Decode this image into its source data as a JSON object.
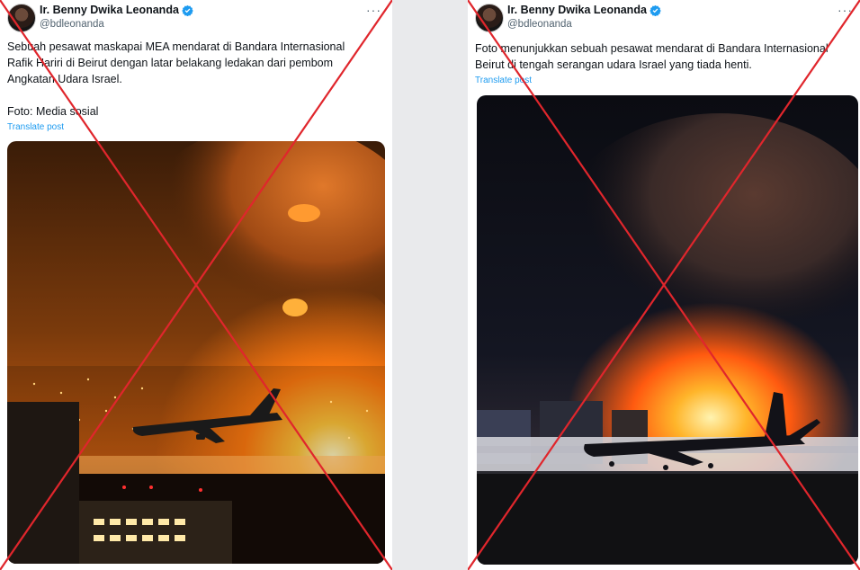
{
  "left_post": {
    "author_name": "Ir. Benny Dwika Leonanda",
    "handle": "@bdleonanda",
    "text": "Sebuah pesawat maskapai MEA mendarat di Bandara Internasional\nRafik Hariri di Beirut dengan latar belakang ledakan dari pembom\nAngkatan Udara Israel.\n\nFoto: Media sosial",
    "translate_label": "Translate post",
    "more_label": "···"
  },
  "right_post": {
    "author_name": "Ir. Benny Dwika Leonanda",
    "handle": "@bdleonanda",
    "text": "Foto menunjukkan sebuah pesawat mendarat di Bandara Internasional\nBeirut di tengah serangan udara Israel yang tiada henti.",
    "translate_label": "Translate post",
    "more_label": "···"
  },
  "colors": {
    "verified": "#1d9bf0",
    "x_overlay": "#e0262c",
    "link": "#1d9bf0"
  },
  "icons": [
    "verified-badge-icon",
    "more-options-icon",
    "x-overlay-icon"
  ]
}
